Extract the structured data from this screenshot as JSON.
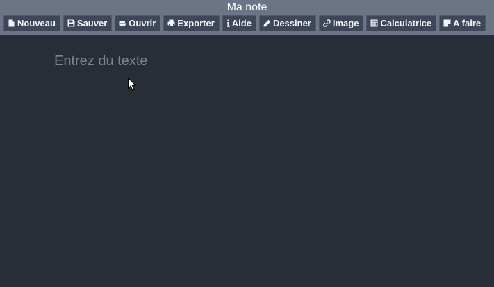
{
  "app": {
    "title": "Ma note"
  },
  "toolbar": {
    "buttons": [
      {
        "label": "Nouveau",
        "icon": "file-icon"
      },
      {
        "label": "Sauver",
        "icon": "floppy-icon"
      },
      {
        "label": "Ouvrir",
        "icon": "folder-open-icon"
      },
      {
        "label": "Exporter",
        "icon": "printer-icon"
      },
      {
        "label": "Aide",
        "icon": "info-icon"
      },
      {
        "label": "Dessiner",
        "icon": "pencil-icon"
      },
      {
        "label": "Image",
        "icon": "link-icon"
      },
      {
        "label": "Calculatrice",
        "icon": "calculator-icon"
      },
      {
        "label": "A faire",
        "icon": "sticky-note-icon"
      }
    ]
  },
  "editor": {
    "value": "",
    "placeholder": "Entrez du texte"
  },
  "colors": {
    "header": "#6b7586",
    "button": "#3f4658",
    "background": "#282e37",
    "text": "#ffffff"
  }
}
